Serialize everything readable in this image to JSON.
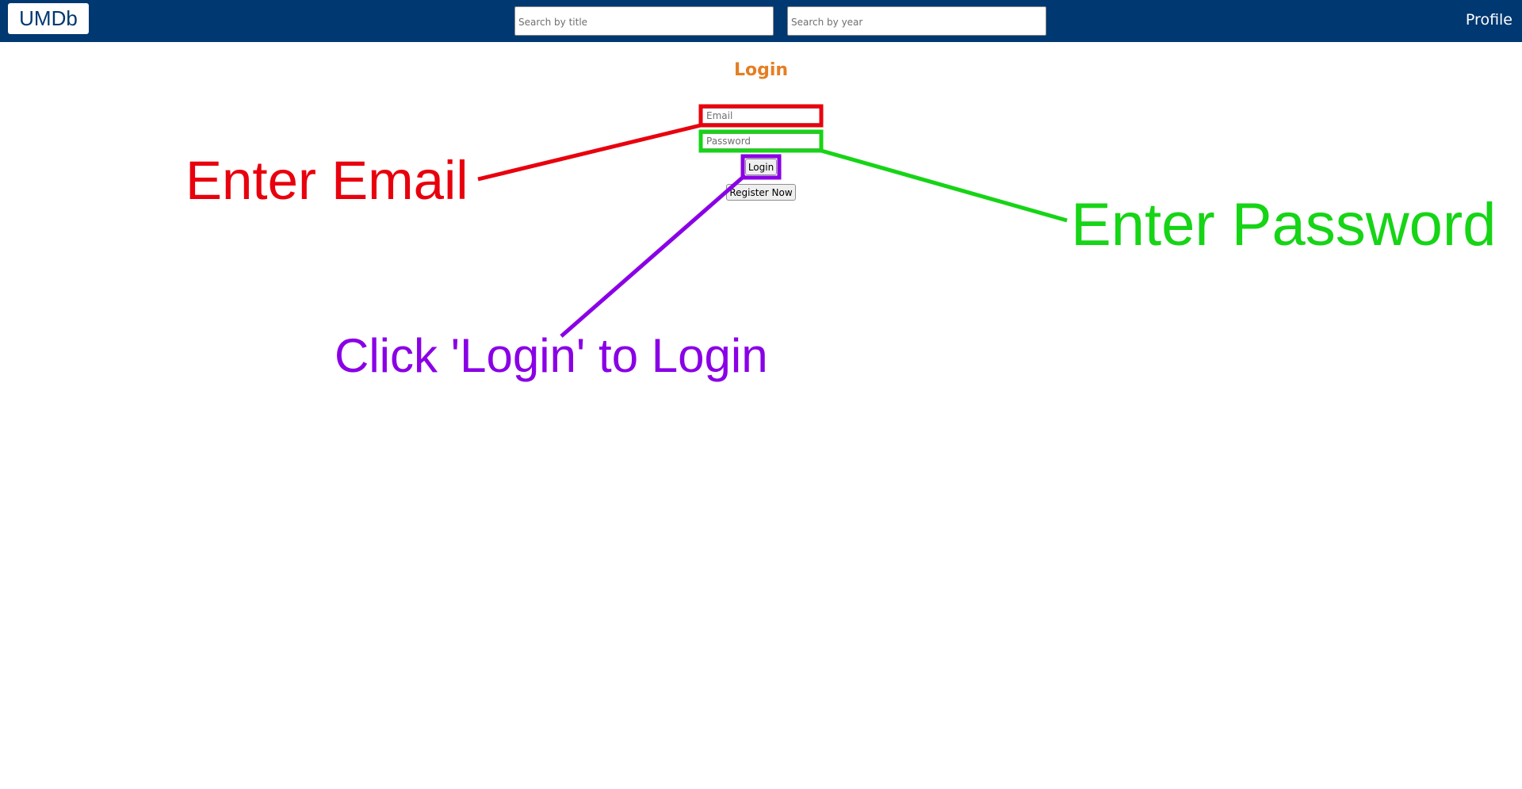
{
  "navbar": {
    "logo": "UMDb",
    "search_title_placeholder": "Search by title",
    "search_year_placeholder": "Search by year",
    "profile_label": "Profile",
    "background_color": "#003871"
  },
  "login": {
    "title": "Login",
    "title_color": "#e67e22",
    "email_placeholder": "Email",
    "password_placeholder": "Password",
    "login_button": "Login",
    "register_button": "Register Now"
  },
  "annotations": {
    "email": {
      "text": "Enter Email",
      "color": "#e8000d"
    },
    "password": {
      "text": "Enter Password",
      "color": "#16d416"
    },
    "login": {
      "text": "Click 'Login' to Login",
      "color": "#8a00e6"
    }
  }
}
